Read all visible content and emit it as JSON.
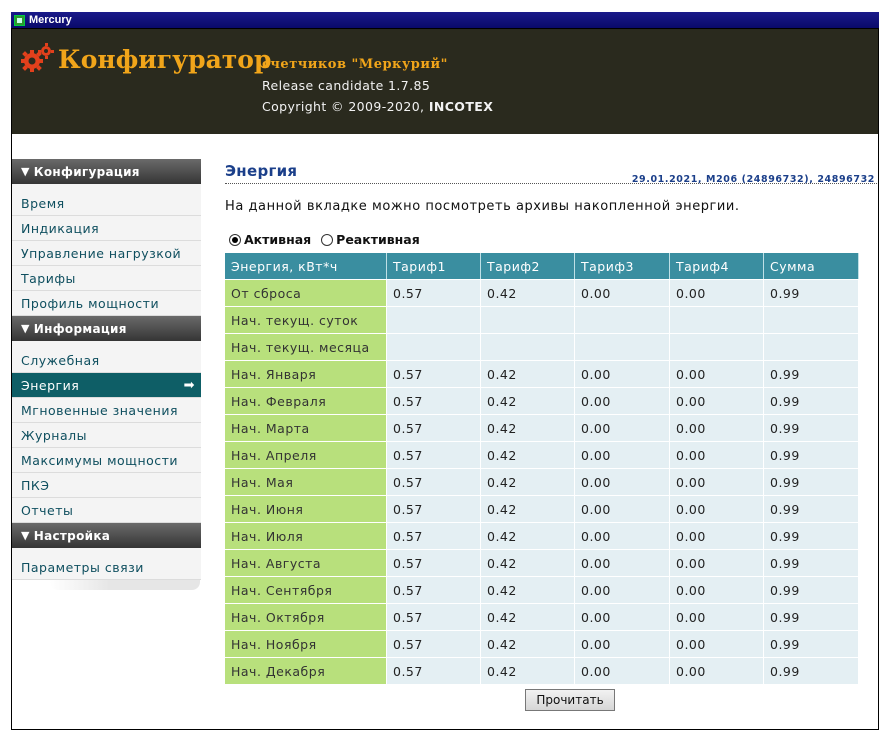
{
  "window": {
    "title": "Mercury"
  },
  "header": {
    "brand": "Конфигуратор",
    "subtitle": "счетчиков \"Меркурий\"",
    "release": "Release candidate 1.7.85",
    "copyright_prefix": "Copyright © 2009-2020, ",
    "copyright_company": "INCOTEX"
  },
  "sidebar": {
    "sections": [
      {
        "title": "Конфигурация",
        "items": [
          "Время",
          "Индикация",
          "Управление нагрузкой",
          "Тарифы",
          "Профиль мощности"
        ]
      },
      {
        "title": "Информация",
        "items": [
          "Служебная",
          "Энергия",
          "Мгновенные значения",
          "Журналы",
          "Максимумы мощности",
          "ПКЭ",
          "Отчеты"
        ]
      },
      {
        "title": "Настройка",
        "items": [
          "Параметры связи"
        ]
      }
    ],
    "active_item": "Энергия",
    "arrow": "➡"
  },
  "content": {
    "title": "Энергия",
    "meter_info": "29.01.2021, М206 (24896732), 24896732",
    "description": "На данной вкладке можно посмотреть архивы накопленной энергии.",
    "radio_active": "Активная",
    "radio_reactive": "Реактивная",
    "selected_mode": "Активная",
    "table": {
      "headers": [
        "Энергия, кВт*ч",
        "Тариф1",
        "Тариф2",
        "Тариф3",
        "Тариф4",
        "Сумма"
      ],
      "rows": [
        [
          "От сброса",
          "0.57",
          "0.42",
          "0.00",
          "0.00",
          "0.99"
        ],
        [
          "Нач. текущ. суток",
          "",
          "",
          "",
          "",
          ""
        ],
        [
          "Нач. текущ. месяца",
          "",
          "",
          "",
          "",
          ""
        ],
        [
          "Нач. Января",
          "0.57",
          "0.42",
          "0.00",
          "0.00",
          "0.99"
        ],
        [
          "Нач. Февраля",
          "0.57",
          "0.42",
          "0.00",
          "0.00",
          "0.99"
        ],
        [
          "Нач. Марта",
          "0.57",
          "0.42",
          "0.00",
          "0.00",
          "0.99"
        ],
        [
          "Нач. Апреля",
          "0.57",
          "0.42",
          "0.00",
          "0.00",
          "0.99"
        ],
        [
          "Нач. Мая",
          "0.57",
          "0.42",
          "0.00",
          "0.00",
          "0.99"
        ],
        [
          "Нач. Июня",
          "0.57",
          "0.42",
          "0.00",
          "0.00",
          "0.99"
        ],
        [
          "Нач. Июля",
          "0.57",
          "0.42",
          "0.00",
          "0.00",
          "0.99"
        ],
        [
          "Нач. Августа",
          "0.57",
          "0.42",
          "0.00",
          "0.00",
          "0.99"
        ],
        [
          "Нач. Сентября",
          "0.57",
          "0.42",
          "0.00",
          "0.00",
          "0.99"
        ],
        [
          "Нач. Октября",
          "0.57",
          "0.42",
          "0.00",
          "0.00",
          "0.99"
        ],
        [
          "Нач. Ноября",
          "0.57",
          "0.42",
          "0.00",
          "0.00",
          "0.99"
        ],
        [
          "Нач. Декабря",
          "0.57",
          "0.42",
          "0.00",
          "0.00",
          "0.99"
        ]
      ]
    },
    "read_button": "Прочитать"
  },
  "colors": {
    "header_bg": "#2a2a1e",
    "brand": "#f1a51a",
    "active_menu": "#0e5e66",
    "table_header": "#3a8ea0",
    "row_label": "#b8e07c",
    "cell_bg": "#e4eff3",
    "title_blue": "#1b3f8a"
  }
}
